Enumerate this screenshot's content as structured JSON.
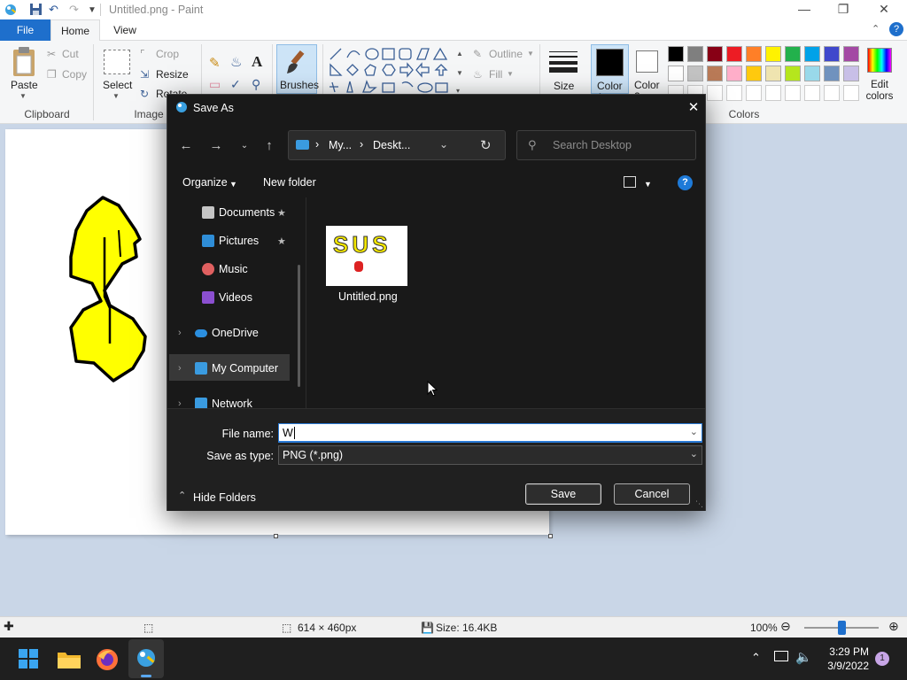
{
  "app": {
    "title": "Untitled.png - Paint"
  },
  "tabs": {
    "file": "File",
    "home": "Home",
    "view": "View"
  },
  "ribbon": {
    "clipboard": {
      "paste": "Paste",
      "cut": "Cut",
      "copy": "Copy",
      "label": "Clipboard"
    },
    "image": {
      "select": "Select",
      "crop": "Crop",
      "resize": "Resize",
      "rotate": "Rotate",
      "label": "Image"
    },
    "tools": {
      "text_icon": "A"
    },
    "brushes": "Brushes",
    "shapes": {
      "outline": "Outline",
      "fill": "Fill"
    },
    "size": "Size",
    "color1": "Color\n1",
    "color2": "Color\n2",
    "colors_label": "Colors",
    "edit_colors": "Edit colors",
    "palette": [
      "#000000",
      "#7f7f7f",
      "#880015",
      "#ed1c24",
      "#ff7f27",
      "#fff200",
      "#22b14c",
      "#00a2e8",
      "#3f48cc",
      "#a349a4",
      "#ffffff",
      "#c3c3c3",
      "#b97a57",
      "#ffaec9",
      "#ffc90e",
      "#efe4b0",
      "#b5e61d",
      "#99d9ea",
      "#7092be",
      "#c8bfe7"
    ]
  },
  "dialog": {
    "title": "Save As",
    "breadcrumb": {
      "part1": "My...",
      "part2": "Deskt..."
    },
    "search_placeholder": "Search Desktop",
    "organize": "Organize",
    "new_folder": "New folder",
    "nav": {
      "documents": "Documents",
      "pictures": "Pictures",
      "music": "Music",
      "videos": "Videos",
      "onedrive": "OneDrive",
      "my_computer": "My Computer",
      "network": "Network"
    },
    "file": {
      "name": "Untitled.png",
      "thumb_text": "SUS"
    },
    "filename_label": "File name:",
    "filename_value": "W",
    "savetype_label": "Save as type:",
    "savetype_value": "PNG (*.png)",
    "hide_folders": "Hide Folders",
    "save": "Save",
    "cancel": "Cancel"
  },
  "status": {
    "dimensions": "614 × 460px",
    "size": "Size: 16.4KB",
    "zoom": "100%"
  },
  "taskbar": {
    "time": "3:29 PM",
    "date": "3/9/2022",
    "badge": "1"
  }
}
